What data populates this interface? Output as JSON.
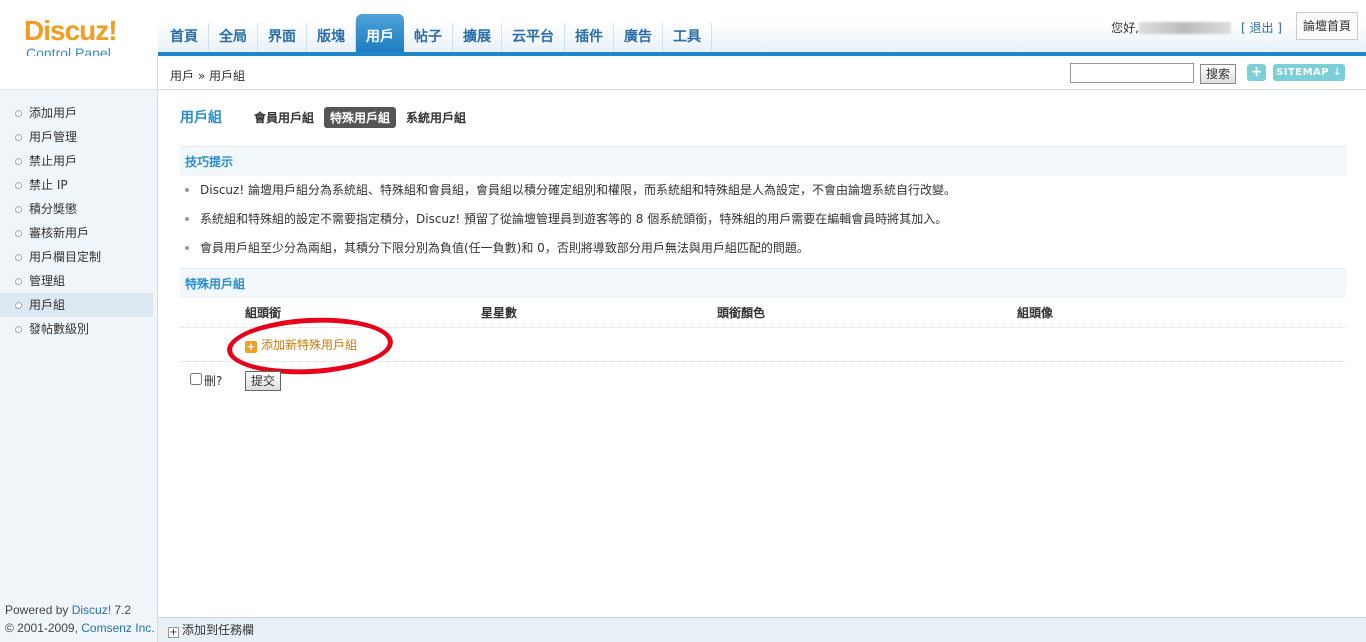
{
  "logo": {
    "brand": "Discuz!",
    "subtitle": "Control Panel"
  },
  "nav": {
    "tabs": [
      "首頁",
      "全局",
      "界面",
      "版塊",
      "用戶",
      "帖子",
      "擴展",
      "云平台",
      "插件",
      "廣告",
      "工具"
    ],
    "active_index": 4
  },
  "topright": {
    "greeting": "您好,",
    "logout": "[ 退出 ]",
    "home": "論壇首頁"
  },
  "crumb": {
    "text": "用戶 » 用戶組"
  },
  "search": {
    "value": "",
    "button": "搜索"
  },
  "toolbar": {
    "plus": "+",
    "sitemap": "SITEMAP ↓"
  },
  "sidebar": {
    "items": [
      "添加用戶",
      "用戶管理",
      "禁止用戶",
      "禁止 IP",
      "積分獎懲",
      "審核新用戶",
      "用戶欄目定制",
      "管理組",
      "用戶組",
      "發帖數級別"
    ],
    "active_index": 8
  },
  "powered": {
    "prefix": "Powered by ",
    "product": "Discuz!",
    "version": " 7.2",
    "copy": "© 2001-2009, ",
    "company": "Comsenz Inc."
  },
  "subtabs": {
    "title": "用戶組",
    "tabs": [
      "會員用戶組",
      "特殊用戶組",
      "系統用戶組"
    ],
    "active_index": 1
  },
  "tips": {
    "heading": "技巧提示",
    "items": [
      "Discuz! 論壇用戶組分為系統組、特殊組和會員組，會員組以積分確定組別和權限，而系統組和特殊組是人為設定，不會由論壇系統自行改變。",
      "系統組和特殊組的設定不需要指定積分，Discuz! 預留了從論壇管理員到遊客等的 8 個系統頭銜，特殊組的用戶需要在編輯會員時將其加入。",
      "會員用戶組至少分為兩組，其積分下限分別為負值(任一負數)和 0，否則將導致部分用戶無法與用戶組匹配的問題。"
    ]
  },
  "grid": {
    "heading": "特殊用戶組",
    "columns": [
      "組頭銜",
      "星星數",
      "頭銜顏色",
      "組頭像"
    ],
    "add_label": "添加新特殊用戶組",
    "delete_label": "刪?",
    "submit_label": "提交"
  },
  "bottombar": {
    "add_to_taskbar": "添加到任務欄"
  }
}
